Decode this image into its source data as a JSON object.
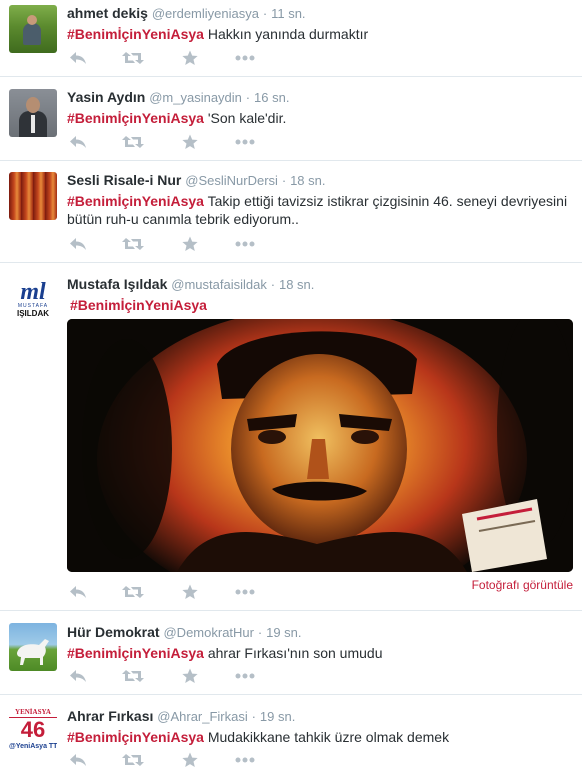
{
  "tweets": [
    {
      "name": "ahmet dekiş",
      "handle": "@erdemliyeniasya",
      "time": "11 sn.",
      "hashtag": "#BenimİçinYeniAsya",
      "text": "Hakkın yanında durmaktır"
    },
    {
      "name": "Yasin Aydın",
      "handle": "@m_yasinaydin",
      "time": "16 sn.",
      "hashtag": "#BenimİçinYeniAsya",
      "text": "'Son kale'dir."
    },
    {
      "name": "Sesli Risale-i Nur",
      "handle": "@SesliNurDersi",
      "time": "18 sn.",
      "hashtag": "#BenimİçinYeniAsya",
      "text": "Takip ettiği tavizsiz istikrar çizgisinin 46. seneyi devriyesini bütün ruh-u canımla tebrik ediyorum.."
    },
    {
      "name": "Mustafa Işıldak",
      "handle": "@mustafaisildak",
      "time": "18 sn.",
      "hashtag": "#BenimİçinYeniAsya",
      "text": "",
      "view_photo": "Fotoğrafı görüntüle",
      "logo_ml": "ml",
      "logo_small": "MUSTAFA",
      "logo_name": "IŞILDAK"
    },
    {
      "name": "Hür Demokrat",
      "handle": "@DemokratHur",
      "time": "19 sn.",
      "hashtag": "#BenimİçinYeniAsya",
      "text": "ahrar Fırkası'nın son umudu"
    },
    {
      "name": "Ahrar Fırkası",
      "handle": "@Ahrar_Firkasi",
      "time": "19 sn.",
      "hashtag": "#BenimİçinYeniAsya",
      "text": "Mudakikkane tahkik üzre olmak demek",
      "logo_top": "YENİASYA",
      "logo_num": "46",
      "logo_bottom": "@YeniAsya TT"
    }
  ],
  "dot": "·",
  "colors": {
    "hashtag": "#c41e3a",
    "muted": "#8899a6",
    "action": "#b5bfc7"
  }
}
